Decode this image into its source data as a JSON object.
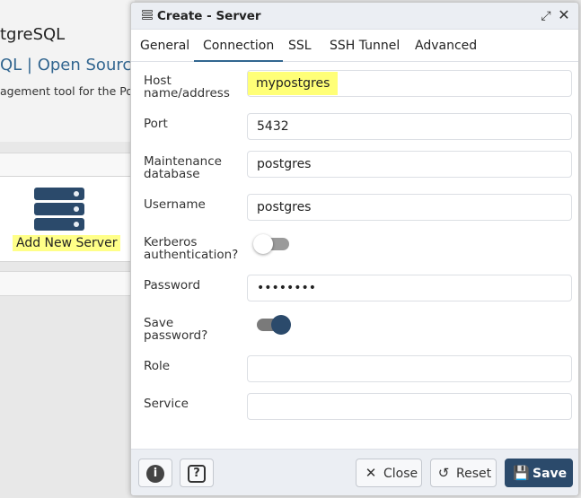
{
  "background": {
    "title": "tgreSQL",
    "subtitle": "QL | Open Source",
    "description": "agement tool for the Po",
    "add_server_label": "Add New Server"
  },
  "dialog": {
    "title": "Create - Server",
    "title_icon": "server-group-icon",
    "maximize_icon": "maximize-icon",
    "close_icon": "close-icon",
    "tabs": [
      {
        "label": "General",
        "active": false
      },
      {
        "label": "Connection",
        "active": true
      },
      {
        "label": "SSL",
        "active": false
      },
      {
        "label": "SSH Tunnel",
        "active": false
      },
      {
        "label": "Advanced",
        "active": false
      }
    ],
    "fields": {
      "host": {
        "label_line1": "Host",
        "label_line2": "name/address",
        "value": "mypostgres"
      },
      "port": {
        "label": "Port",
        "value": "5432"
      },
      "maintenance_db": {
        "label_line1": "Maintenance",
        "label_line2": "database",
        "value": "postgres"
      },
      "username": {
        "label": "Username",
        "value": "postgres"
      },
      "kerberos": {
        "label_line1": "Kerberos",
        "label_line2": "authentication?",
        "on": false
      },
      "password": {
        "label": "Password",
        "value": "••••••••"
      },
      "save_password": {
        "label_line1": "Save",
        "label_line2": "password?",
        "on": true
      },
      "role": {
        "label": "Role",
        "value": ""
      },
      "service": {
        "label": "Service",
        "value": ""
      }
    },
    "footer": {
      "info_icon": "info-icon",
      "help_icon": "help-icon",
      "close_label": "Close",
      "reset_label": "Reset",
      "save_label": "Save"
    },
    "colors": {
      "accent": "#326690",
      "primary_button": "#2b4a6b",
      "highlight": "#ffff77"
    }
  }
}
